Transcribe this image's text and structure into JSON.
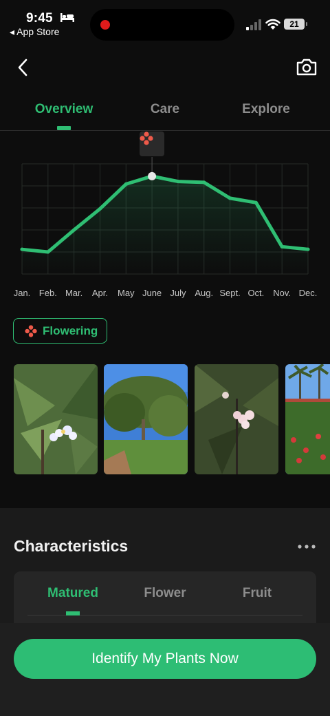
{
  "status_bar": {
    "time": "9:45",
    "back_app": "◂ App Store",
    "battery": "21"
  },
  "tabs": [
    {
      "label": "Overview",
      "active": true
    },
    {
      "label": "Care",
      "active": false
    },
    {
      "label": "Explore",
      "active": false
    }
  ],
  "chart_data": {
    "type": "line",
    "categories": [
      "Jan.",
      "Feb.",
      "Mar.",
      "Apr.",
      "May",
      "June",
      "July",
      "Aug.",
      "Sept.",
      "Oct.",
      "Nov.",
      "Dec."
    ],
    "values": [
      0.28,
      0.25,
      0.5,
      0.74,
      1.02,
      1.11,
      1.05,
      1.04,
      0.86,
      0.81,
      0.31,
      0.28
    ],
    "ylim": [
      0,
      1.25
    ],
    "grid": true,
    "highlight_index": 5,
    "line_color": "#2fbe73"
  },
  "chip": {
    "label": "Flowering",
    "icon": "flower-icon"
  },
  "photos": [
    "plumeria-white-flowers",
    "plumeria-tree-blue-sky",
    "plumeria-pink-flowers",
    "garden-palms-red-flowers"
  ],
  "characteristics": {
    "title": "Characteristics",
    "tabs": [
      {
        "label": "Matured",
        "active": true
      },
      {
        "label": "Flower",
        "active": false
      },
      {
        "label": "Fruit",
        "active": false
      }
    ]
  },
  "cta": {
    "label": "Identify My Plants Now"
  },
  "colors": {
    "accent": "#2fbe73",
    "flower": "#ee5a4a",
    "background": "#0d0d0d"
  }
}
